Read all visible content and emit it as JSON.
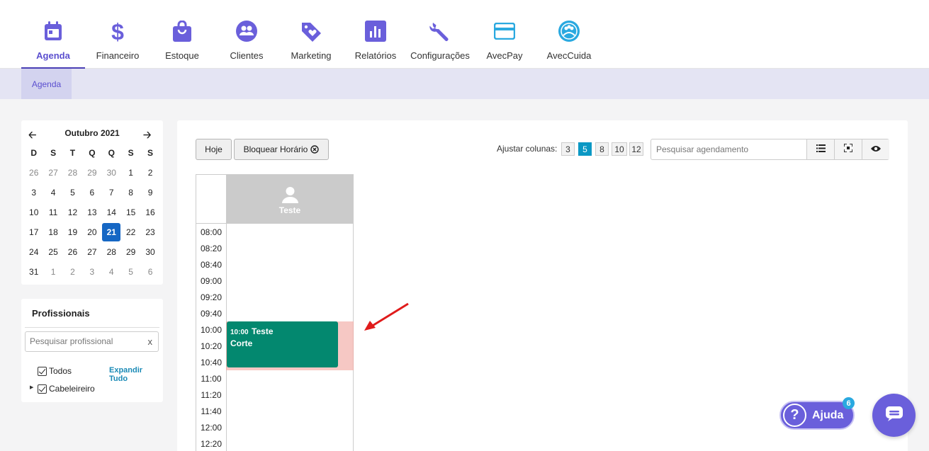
{
  "nav": {
    "items": [
      {
        "label": "Agenda",
        "icon": "calendar-icon"
      },
      {
        "label": "Financeiro",
        "icon": "dollar-icon"
      },
      {
        "label": "Estoque",
        "icon": "shopping-bag-icon"
      },
      {
        "label": "Clientes",
        "icon": "clients-icon"
      },
      {
        "label": "Marketing",
        "icon": "tag-heart-icon"
      },
      {
        "label": "Relatórios",
        "icon": "bar-chart-icon"
      },
      {
        "label": "Configurações",
        "icon": "wrench-icon"
      },
      {
        "label": "AvecPay",
        "icon": "credit-card-icon"
      },
      {
        "label": "AvecCuida",
        "icon": "avec-cuida-logo-icon"
      }
    ],
    "active": "Agenda"
  },
  "subnav": {
    "tab": "Agenda"
  },
  "calendar": {
    "title": "Outubro 2021",
    "weekdays": [
      "D",
      "S",
      "T",
      "Q",
      "Q",
      "S",
      "S"
    ],
    "weeks": [
      [
        "26",
        "27",
        "28",
        "29",
        "30",
        "1",
        "2"
      ],
      [
        "3",
        "4",
        "5",
        "6",
        "7",
        "8",
        "9"
      ],
      [
        "10",
        "11",
        "12",
        "13",
        "14",
        "15",
        "16"
      ],
      [
        "17",
        "18",
        "19",
        "20",
        "21",
        "22",
        "23"
      ],
      [
        "24",
        "25",
        "26",
        "27",
        "28",
        "29",
        "30"
      ],
      [
        "31",
        "1",
        "2",
        "3",
        "4",
        "5",
        "6"
      ]
    ],
    "selected": "21"
  },
  "profissionais": {
    "title": "Profissionais",
    "search_placeholder": "Pesquisar profissional",
    "clear": "x",
    "todos": "Todos",
    "expandir": "Expandir Tudo",
    "group": "Cabeleireiro"
  },
  "toolbar": {
    "hoje": "Hoje",
    "bloquear": "Bloquear Horário",
    "ajustar_label": "Ajustar colunas:",
    "columns": [
      "3",
      "5",
      "8",
      "10",
      "12"
    ],
    "active_column": "5",
    "search_placeholder": "Pesquisar agendamento"
  },
  "schedule": {
    "professional": "Teste",
    "times": [
      "08:00",
      "08:20",
      "08:40",
      "09:00",
      "09:20",
      "09:40",
      "10:00",
      "10:20",
      "10:40",
      "11:00",
      "11:20",
      "11:40",
      "12:00",
      "12:20"
    ],
    "busy_times": [
      "10:00",
      "10:20",
      "10:40"
    ],
    "appointment": {
      "time": "10:00",
      "client": "Teste",
      "service": "Corte",
      "color": "#03886f"
    }
  },
  "help": {
    "label": "Ajuda",
    "badge": "6"
  },
  "colors": {
    "accent": "#5b4fcf",
    "selected_day": "#1667c4",
    "active_column": "#0b98c4",
    "busy_slot": "#f6c8c4"
  }
}
